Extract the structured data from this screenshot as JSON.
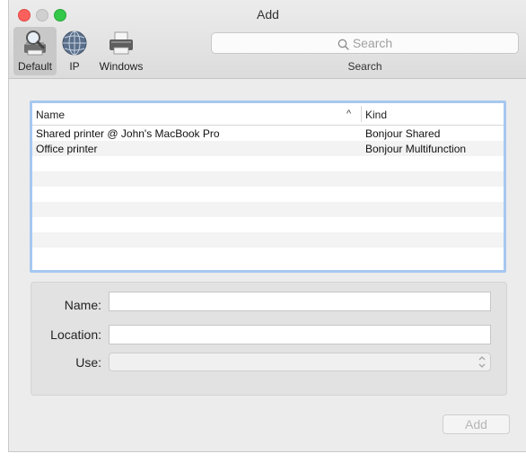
{
  "window": {
    "title": "Add"
  },
  "toolbar": {
    "tabs": [
      {
        "label": "Default",
        "icon": "printer-magnifier-icon",
        "selected": true
      },
      {
        "label": "IP",
        "icon": "globe-icon",
        "selected": false
      },
      {
        "label": "Windows",
        "icon": "windows-printer-icon",
        "selected": false
      }
    ],
    "search_placeholder": "Search",
    "search_caption": "Search"
  },
  "printer_list": {
    "columns": [
      "Name",
      "Kind"
    ],
    "sort_indicator": "^",
    "rows": [
      {
        "name": "Shared printer @ John's MacBook Pro",
        "kind": "Bonjour Shared"
      },
      {
        "name": "Office printer",
        "kind": "Bonjour Multifunction"
      }
    ]
  },
  "form": {
    "name_label": "Name:",
    "name_value": "",
    "location_label": "Location:",
    "location_value": "",
    "use_label": "Use:",
    "use_value": ""
  },
  "actions": {
    "add_label": "Add",
    "add_enabled": false
  },
  "colors": {
    "selection_ring": "#a6c8f0",
    "close": "#fc605c",
    "zoom": "#34c84a"
  }
}
